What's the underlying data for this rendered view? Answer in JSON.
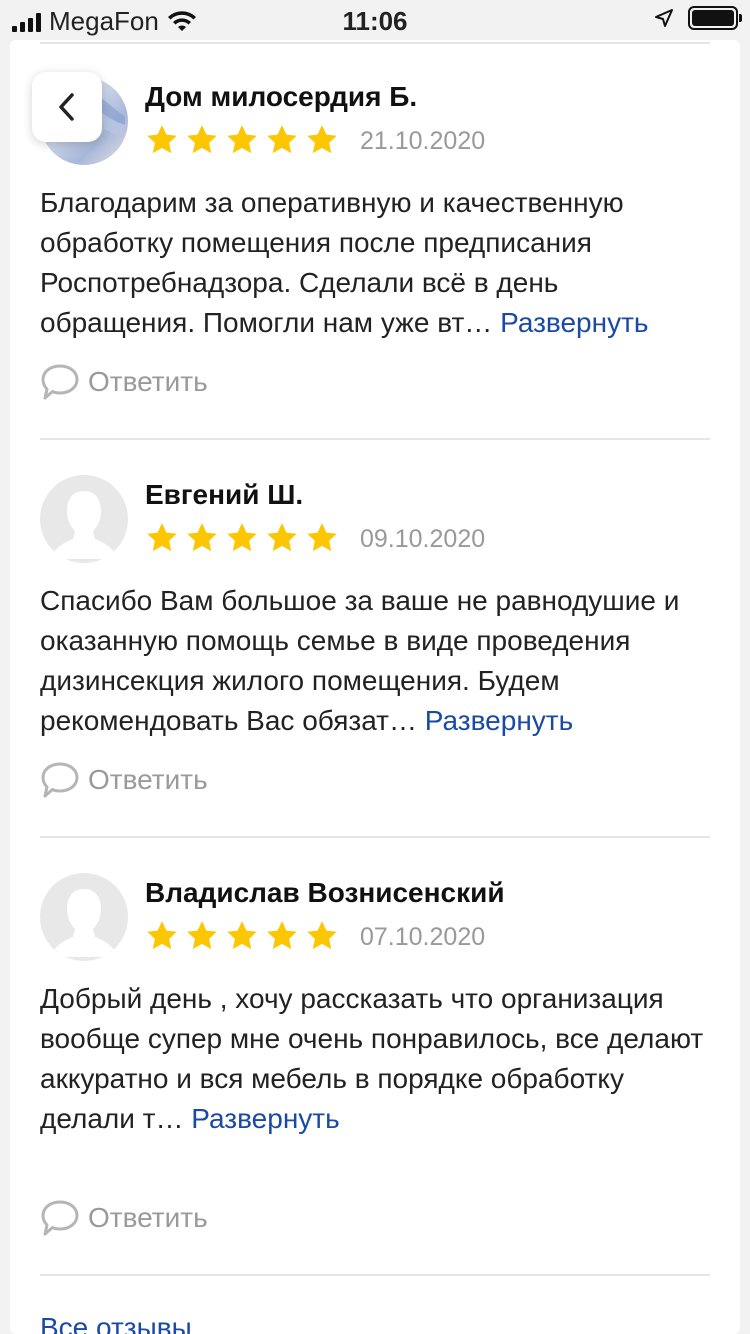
{
  "status_bar": {
    "carrier": "MegaFon",
    "time": "11:06"
  },
  "reviews": [
    {
      "author": "Дом милосердия Б.",
      "rating": 5,
      "date": "21.10.2020",
      "text": "Благодарим за оперативную и качественную обработку помещения после предписания Роспотребнадзора. Сделали всё в день обращения. Помогли нам уже вт…",
      "expand_label": "Развернуть",
      "reply_label": "Ответить",
      "avatar": "photo"
    },
    {
      "author": "Евгений Ш.",
      "rating": 5,
      "date": "09.10.2020",
      "text": "Спасибо Вам большое за ваше не равнодушие и оказанную помощь семье в виде проведения дизинсекция жилого помещения. Будем рекомендовать Вас обязат…",
      "expand_label": "Развернуть",
      "reply_label": "Ответить",
      "avatar": "placeholder"
    },
    {
      "author": "Владислав Вознисенский",
      "rating": 5,
      "date": "07.10.2020",
      "text": "Добрый день , хочу рассказать что организация вообще супер мне очень понравилось, все делают аккуратно и вся мебель в порядке обработку делали т…",
      "expand_label": "Развернуть",
      "reply_label": "Ответить",
      "avatar": "placeholder"
    }
  ],
  "footer": {
    "all_reviews_label": "Все отзывы"
  },
  "colors": {
    "star": "#fcc600",
    "link": "#1a4aa5",
    "muted": "#9a9a9a"
  }
}
